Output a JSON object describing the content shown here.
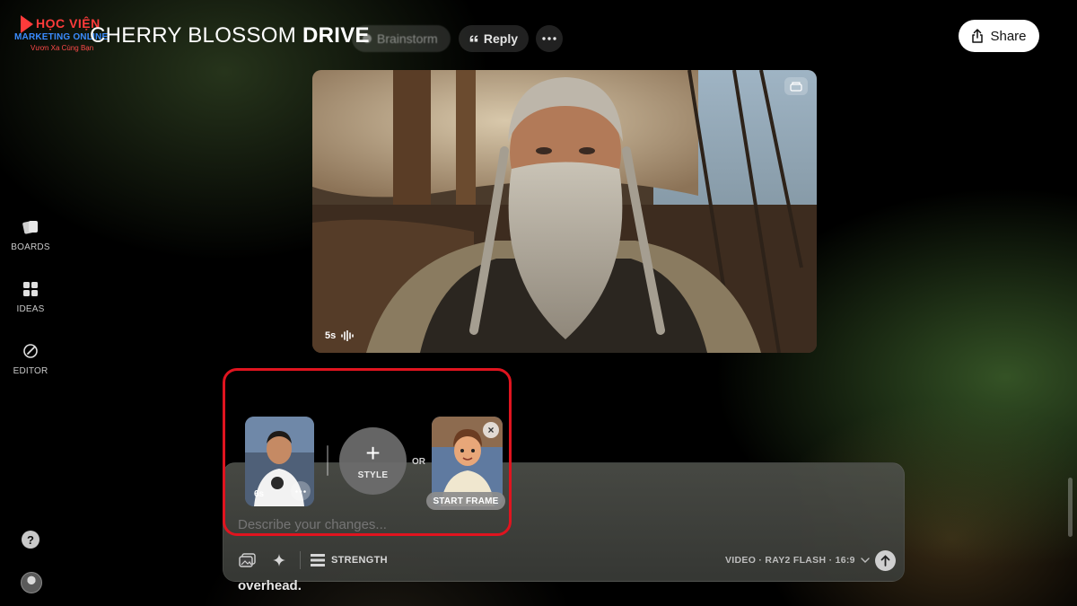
{
  "brand": {
    "line1": "HỌC VIỆN",
    "line2": "MARKETING ONLINE",
    "line3": "Vươn Xa Cùng Bạn"
  },
  "header": {
    "title_light": "CHERRY BLOSSOM",
    "title_bold": "DRIVE",
    "brainstorm_label": "Brainstorm",
    "reply_label": "Reply",
    "more_icon": "more-horizontal-icon",
    "share_label": "Share"
  },
  "sidebar": {
    "items": [
      {
        "label": "BOARDS",
        "icon": "boards-icon"
      },
      {
        "label": "IDEAS",
        "icon": "ideas-grid-icon"
      },
      {
        "label": "EDITOR",
        "icon": "editor-icon"
      }
    ],
    "help_label": "?"
  },
  "video": {
    "duration": "5s",
    "audio_icon": "audio-waveform-icon"
  },
  "attachments": {
    "video_thumb_duration": "6s",
    "style_plus": "+",
    "style_label": "STYLE",
    "or_label": "OR",
    "start_frame_label": "START FRAME",
    "close_glyph": "×"
  },
  "composer": {
    "placeholder": "Describe your changes...",
    "strength_label": "STRENGTH",
    "model_label": "VIDEO · RAY2 FLASH · 16:9"
  },
  "below_text": "overhead.",
  "colors": {
    "highlight": "#e0141f",
    "brand_red": "#ff3b3b",
    "brand_blue": "#3b8cff"
  }
}
